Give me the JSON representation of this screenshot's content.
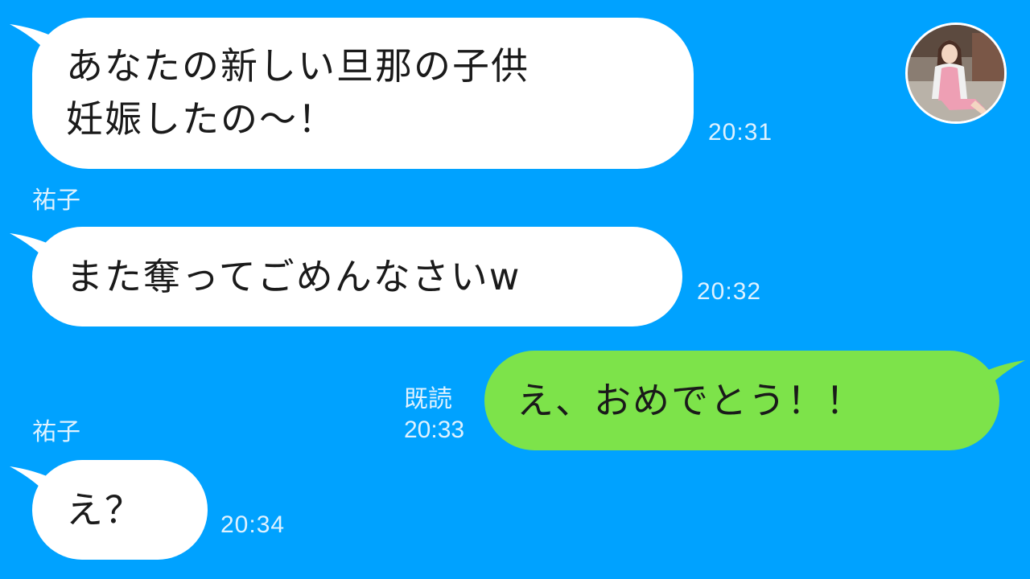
{
  "conversation": {
    "messages": [
      {
        "side": "incoming",
        "lines": [
          "あなたの新しい旦那の子供",
          "妊娠したの〜！"
        ],
        "time": "20:31"
      },
      {
        "side": "incoming",
        "sender": "祐子",
        "lines": [
          "また奪ってごめんなさいw"
        ],
        "time": "20:32"
      },
      {
        "side": "outgoing",
        "read_status": "既読",
        "lines": [
          "え、おめでとう！！"
        ],
        "time": "20:33"
      },
      {
        "side": "incoming",
        "sender": "祐子",
        "lines": [
          "え？"
        ],
        "time": "20:34"
      }
    ]
  },
  "colors": {
    "background": "#00a2ff",
    "incoming_bubble": "#ffffff",
    "outgoing_bubble": "#7de34a",
    "meta_text": "#dff2ff"
  },
  "icons": {
    "avatar": "contact-avatar-photo"
  }
}
